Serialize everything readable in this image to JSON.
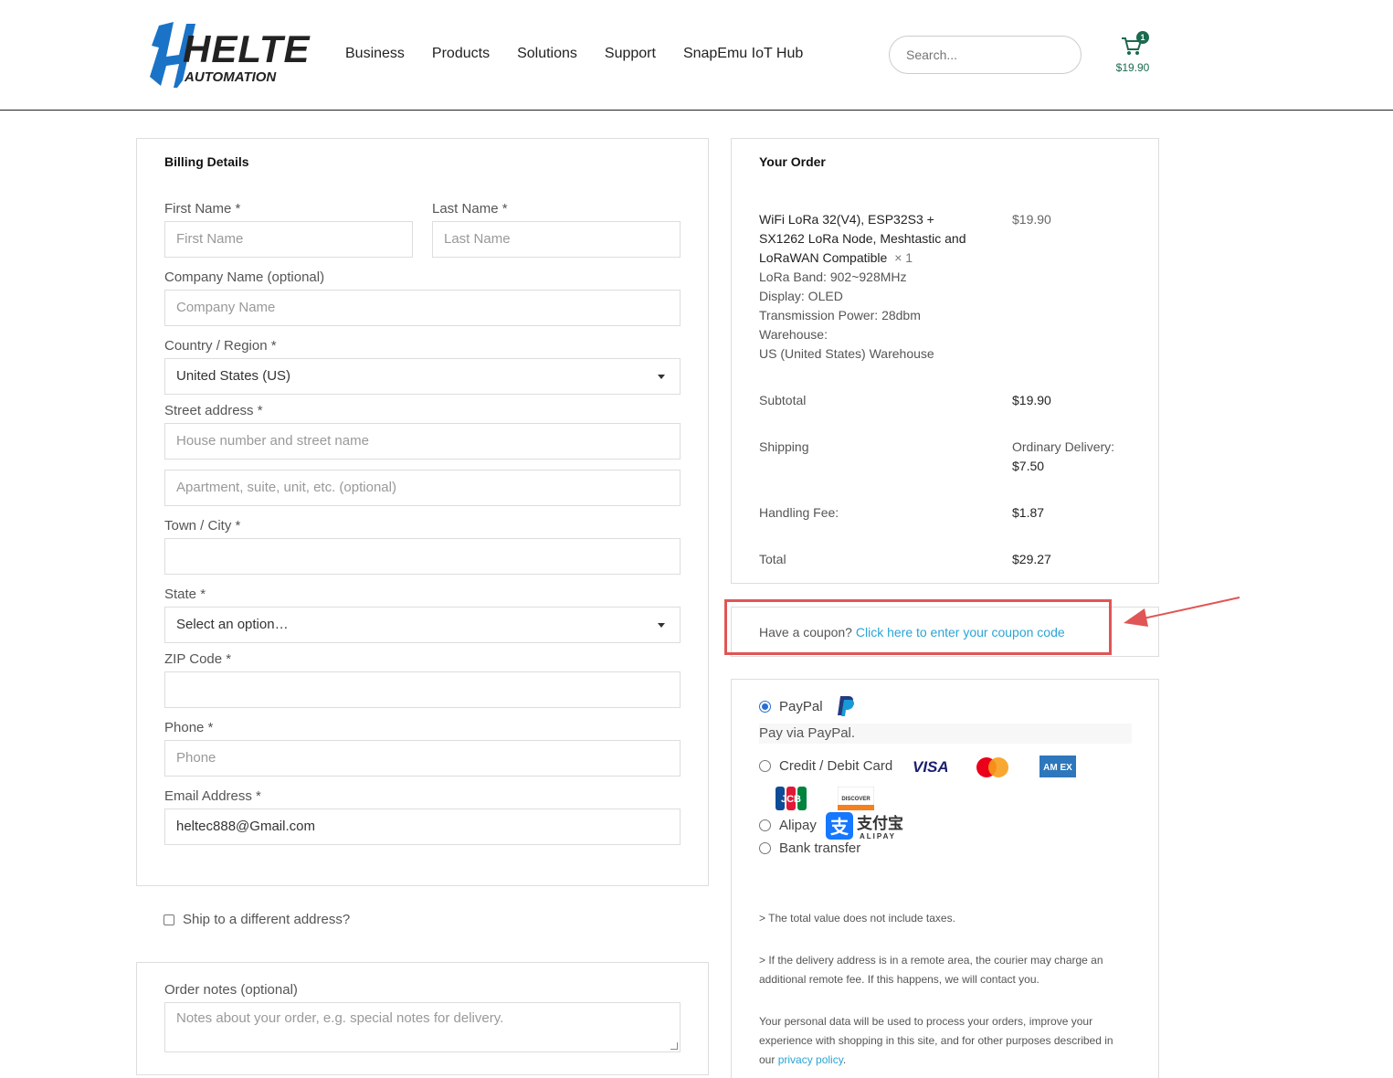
{
  "header": {
    "logo_top": "HELTEC",
    "logo_bottom": "AUTOMATION",
    "nav": [
      "Business",
      "Products",
      "Solutions",
      "Support",
      "SnapEmu IoT Hub"
    ],
    "search_placeholder": "Search...",
    "cart_count": "1",
    "cart_total": "$19.90"
  },
  "billing": {
    "title": "Billing Details",
    "first_name_label": "First Name *",
    "first_name_placeholder": "First Name",
    "last_name_label": "Last Name *",
    "last_name_placeholder": "Last Name",
    "company_label": "Company Name (optional)",
    "company_placeholder": "Company Name",
    "country_label": "Country / Region *",
    "country_value": "United States (US)",
    "street_label": "Street address *",
    "street_placeholder": "House number and street name",
    "apt_placeholder": "Apartment, suite, unit, etc. (optional)",
    "city_label": "Town / City *",
    "state_label": "State *",
    "state_value": "Select an option…",
    "zip_label": "ZIP Code *",
    "phone_label": "Phone *",
    "phone_placeholder": "Phone",
    "email_label": "Email Address *",
    "email_value": "heltec888@Gmail.com"
  },
  "ship_different": "Ship to a different address?",
  "notes": {
    "label": "Order notes (optional)",
    "placeholder": "Notes about your order, e.g. special notes for delivery."
  },
  "order": {
    "title": "Your Order",
    "product_name": "WiFi LoRa 32(V4), ESP32S3 + SX1262 LoRa Node, Meshtastic and LoRaWAN Compatible",
    "product_qty": "× 1",
    "product_price": "$19.90",
    "attributes": [
      "LoRa Band: 902~928MHz",
      "Display: OLED",
      "Transmission Power: 28dbm",
      "Warehouse:",
      "US (United States) Warehouse"
    ],
    "subtotal_label": "Subtotal",
    "subtotal_value": "$19.90",
    "shipping_label": "Shipping",
    "shipping_method": "Ordinary Delivery:",
    "shipping_value": "$7.50",
    "handling_label": "Handling Fee:",
    "handling_value": "$1.87",
    "total_label": "Total",
    "total_value": "$29.27"
  },
  "coupon": {
    "text": "Have a coupon?",
    "link": "Click here to enter your coupon code"
  },
  "payment": {
    "paypal_label": "PayPal",
    "paypal_desc": "Pay via PayPal.",
    "card_label": "Credit / Debit Card",
    "visa": "VISA",
    "amex": "AM EX",
    "jcb": "JCB",
    "discover": "DISCOVER",
    "alipay_label": "Alipay",
    "alipay_cn": "支付宝",
    "alipay_en": "ALIPAY",
    "bank_label": "Bank transfer",
    "note1": "> The total value does not include taxes.",
    "note2": "> If the delivery address is in a remote area, the courier may charge an additional remote fee. If this happens, we will contact you.",
    "privacy_text": "Your personal data will be used to process your orders, improve your experience with shopping in this site, and for other purposes described in our",
    "privacy_link": "privacy policy",
    "privacy_end": "."
  },
  "colors": {
    "brand_blue": "#1a73c6",
    "link": "#2aa4d5",
    "cart_green": "#1b6a4d",
    "highlight_red": "#e05555"
  }
}
